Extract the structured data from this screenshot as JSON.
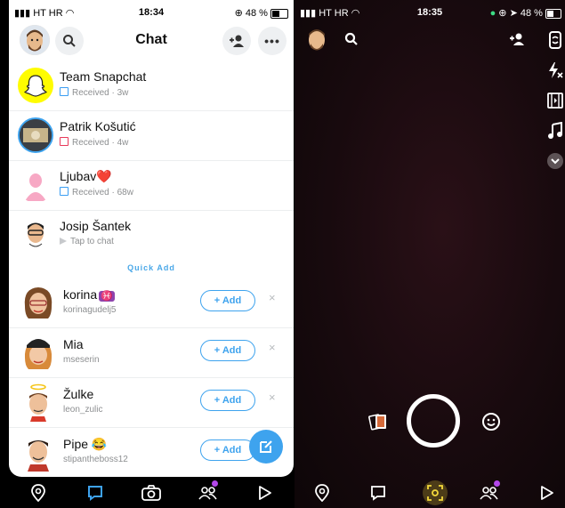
{
  "left": {
    "status": {
      "carrier": "HT HR",
      "time": "18:34",
      "battery": "48 %"
    },
    "header": {
      "title": "Chat"
    },
    "chats": [
      {
        "name": "Team Snapchat",
        "status": "Received",
        "time": "3w",
        "status_kind": "received-blue"
      },
      {
        "name": "Patrik Košutić",
        "status": "Received",
        "time": "4w",
        "status_kind": "received-red"
      },
      {
        "name": "Ljubav",
        "emoji": "❤️",
        "status": "Received",
        "time": "68w",
        "status_kind": "received-blue"
      },
      {
        "name": "Josip Šantek",
        "status": "Tap to chat",
        "time": "",
        "status_kind": "tap"
      }
    ],
    "quick_add": {
      "heading": "Quick Add",
      "add_label": "+ Add",
      "dismiss": "×",
      "people": [
        {
          "name": "korina",
          "emoji": "♓",
          "username": "korinagudelj5"
        },
        {
          "name": "Mia",
          "emoji": "",
          "username": "mseserin"
        },
        {
          "name": "Žulke",
          "emoji": "",
          "username": "leon_zulic"
        },
        {
          "name": "Pipe",
          "emoji": "😂",
          "username": "stipantheboss12"
        }
      ]
    }
  },
  "right": {
    "status": {
      "carrier": "HT HR",
      "time": "18:35",
      "battery": "48 %"
    }
  },
  "colors": {
    "accent": "#3ea3ee",
    "notification": "#b347ea",
    "active_nav": "#f5d93b"
  },
  "icons": [
    "search-icon",
    "add-friend-icon",
    "more-icon",
    "map-icon",
    "chat-icon",
    "camera-icon",
    "friends-icon",
    "discover-icon",
    "flip-camera-icon",
    "flash-off-icon",
    "video-reel-icon",
    "music-icon",
    "chevron-down-icon",
    "memories-icon",
    "lens-icon",
    "scan-icon"
  ]
}
